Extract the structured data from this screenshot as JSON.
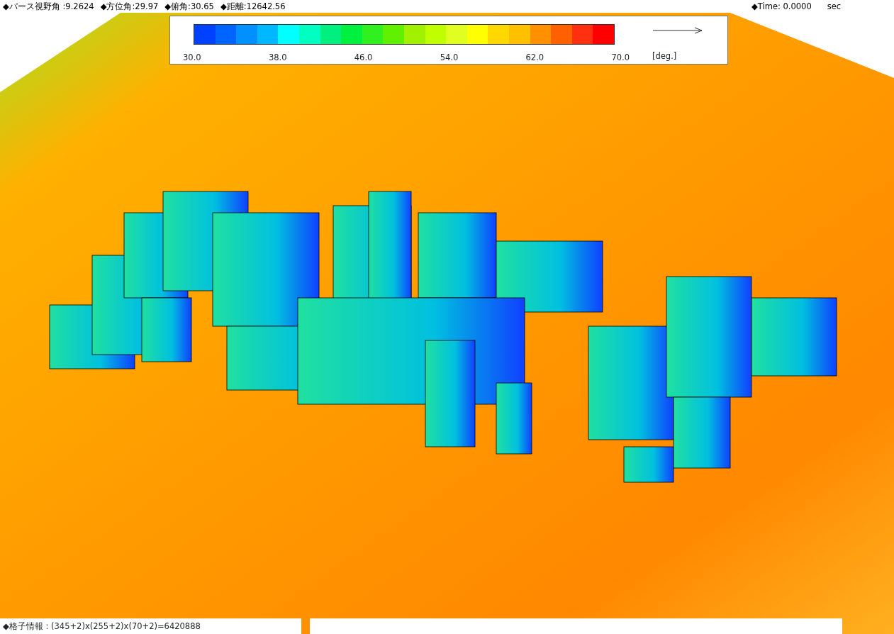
{
  "header": {
    "left_items": [
      "◆パース視野角 :9.2624",
      "◆方位角:29.97",
      "◆俯角:30.65",
      "◆距離:12642.56"
    ],
    "time_label": "◆Time: 0.0000",
    "time_unit": "sec"
  },
  "legend": {
    "swatches": [
      {
        "color": "#0040ff"
      },
      {
        "color": "#0064ff"
      },
      {
        "color": "#0090ff"
      },
      {
        "color": "#00b8ff"
      },
      {
        "color": "#00ffff"
      },
      {
        "color": "#00ffc0"
      },
      {
        "color": "#00f080"
      },
      {
        "color": "#00f040"
      },
      {
        "color": "#30f020"
      },
      {
        "color": "#60f000"
      },
      {
        "color": "#a0f000"
      },
      {
        "color": "#c0ff00"
      },
      {
        "color": "#e0ff20"
      },
      {
        "color": "#ffff00"
      },
      {
        "color": "#ffd800"
      },
      {
        "color": "#ffc000"
      },
      {
        "color": "#ff9000"
      },
      {
        "color": "#ff6000"
      },
      {
        "color": "#ff3010"
      },
      {
        "color": "#ff0000"
      }
    ],
    "tick_labels": [
      "30.0",
      "38.0",
      "46.0",
      "54.0",
      "62.0",
      "70.0"
    ],
    "unit": "[deg.]"
  },
  "footer": {
    "grid_info": "◆格子情報 : (345+2)x(255+2)x(70+2)=6420888"
  }
}
